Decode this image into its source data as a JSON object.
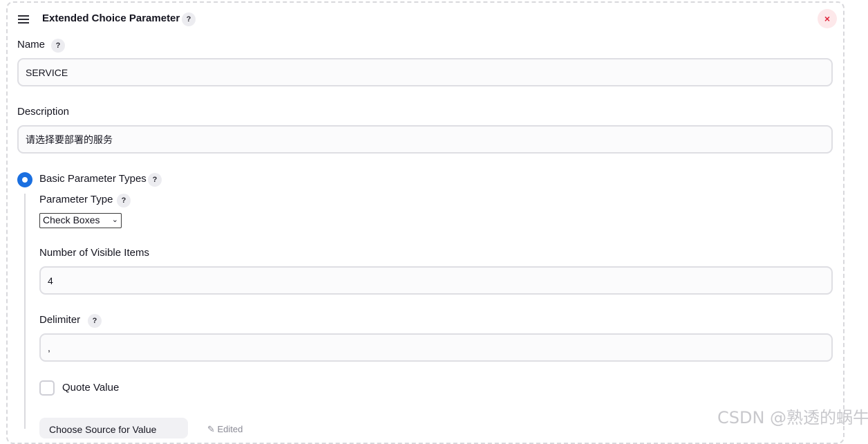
{
  "header": {
    "title": "Extended Choice Parameter",
    "help": "?",
    "close": "×"
  },
  "name": {
    "label": "Name",
    "value": "SERVICE"
  },
  "description": {
    "label": "Description",
    "value": "请选择要部署的服务"
  },
  "basic_types": {
    "label": "Basic Parameter Types",
    "selected": true
  },
  "parameter_type": {
    "label": "Parameter Type",
    "selected": "Check Boxes"
  },
  "visible_items": {
    "label": "Number of Visible Items",
    "value": "4"
  },
  "delimiter": {
    "label": "Delimiter",
    "value": ","
  },
  "quote_value": {
    "label": "Quote Value",
    "checked": false
  },
  "source": {
    "button_label": "Choose Source for Value",
    "edited": "Edited"
  },
  "watermark": "CSDN @熟透的蜗牛",
  "colors": {
    "accent": "#1a6fe0",
    "close": "#e0263c",
    "close_bg": "#fde8ea"
  }
}
